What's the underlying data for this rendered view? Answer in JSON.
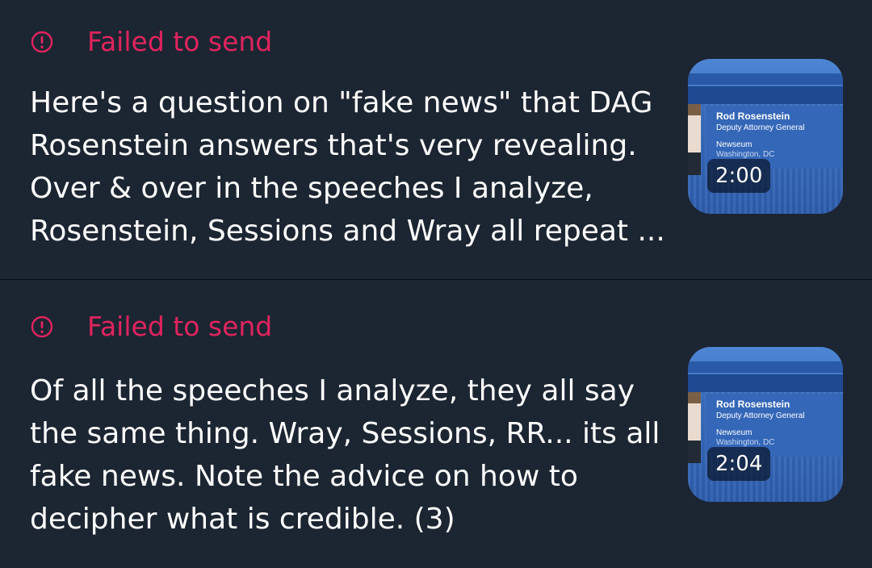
{
  "colors": {
    "background": "#1c2532",
    "error": "#e0245e",
    "text": "#ffffff",
    "divider": "#0b0f15"
  },
  "drafts": [
    {
      "status_icon": "alert-circle-icon",
      "status": "Failed to send",
      "text": "Here's a question on \"fake news\" that DAG Rosenstein answers that's very revealing. Over & over in the speeches I analyze, Rosenstein, Sessions and Wray all repeat ...",
      "thumbnail": {
        "name": "Rod Rosenstein",
        "title": "Deputy Attorney General",
        "venue": "Newseum",
        "location": "Washington, DC",
        "duration": "2:00"
      }
    },
    {
      "status_icon": "alert-circle-icon",
      "status": "Failed to send",
      "text": "Of all the speeches I analyze, they all say the same thing. Wray, Sessions, RR... its all fake news. Note the advice on how to decipher what is credible. (3)",
      "thumbnail": {
        "name": "Rod Rosenstein",
        "title": "Deputy Attorney General",
        "venue": "Newseum",
        "location": "Washington, DC",
        "duration": "2:04"
      }
    }
  ]
}
